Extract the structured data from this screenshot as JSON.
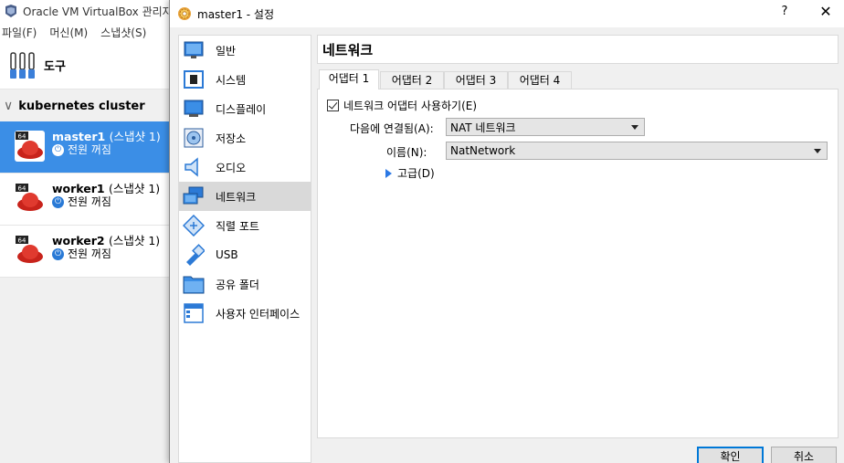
{
  "main_window": {
    "title": "Oracle VM VirtualBox 관리자",
    "menu": [
      "파일(F)",
      "머신(M)",
      "스냅샷(S)"
    ],
    "tools_label": "도구",
    "group_label": "kubernetes cluster",
    "vms": [
      {
        "name": "master1",
        "snapshot": "(스냅샷 1)",
        "state": "전원 꺼짐",
        "badge": "64",
        "selected": true
      },
      {
        "name": "worker1",
        "snapshot": "(스냅샷 1)",
        "state": "전원 꺼짐",
        "badge": "64",
        "selected": false
      },
      {
        "name": "worker2",
        "snapshot": "(스냅샷 1)",
        "state": "전원 꺼짐",
        "badge": "64",
        "selected": false
      }
    ]
  },
  "dialog": {
    "title": "master1 - 설정",
    "help": "?",
    "close": "✕",
    "nav": [
      {
        "label": "일반",
        "icon": "general-icon"
      },
      {
        "label": "시스템",
        "icon": "system-icon"
      },
      {
        "label": "디스플레이",
        "icon": "display-icon"
      },
      {
        "label": "저장소",
        "icon": "storage-icon"
      },
      {
        "label": "오디오",
        "icon": "audio-icon"
      },
      {
        "label": "네트워크",
        "icon": "network-icon",
        "active": true
      },
      {
        "label": "직렬 포트",
        "icon": "serial-port-icon"
      },
      {
        "label": "USB",
        "icon": "usb-icon"
      },
      {
        "label": "공유 폴더",
        "icon": "shared-folder-icon"
      },
      {
        "label": "사용자 인터페이스",
        "icon": "user-interface-icon"
      }
    ],
    "section_title": "네트워크",
    "tabs": [
      "어댑터 1",
      "어댑터 2",
      "어댑터 3",
      "어댑터 4"
    ],
    "enable_label": "네트워크 어댑터 사용하기(E)",
    "attached_label": "다음에 연결됨(A):",
    "attached_value": "NAT 네트워크",
    "name_label": "이름(N):",
    "name_value": "NatNetwork",
    "advanced_label": "고급(D)",
    "ok_label": "확인",
    "cancel_label": "취소"
  },
  "colors": {
    "selection": "#3b8ee6",
    "accent_blue": "#0078d7"
  }
}
